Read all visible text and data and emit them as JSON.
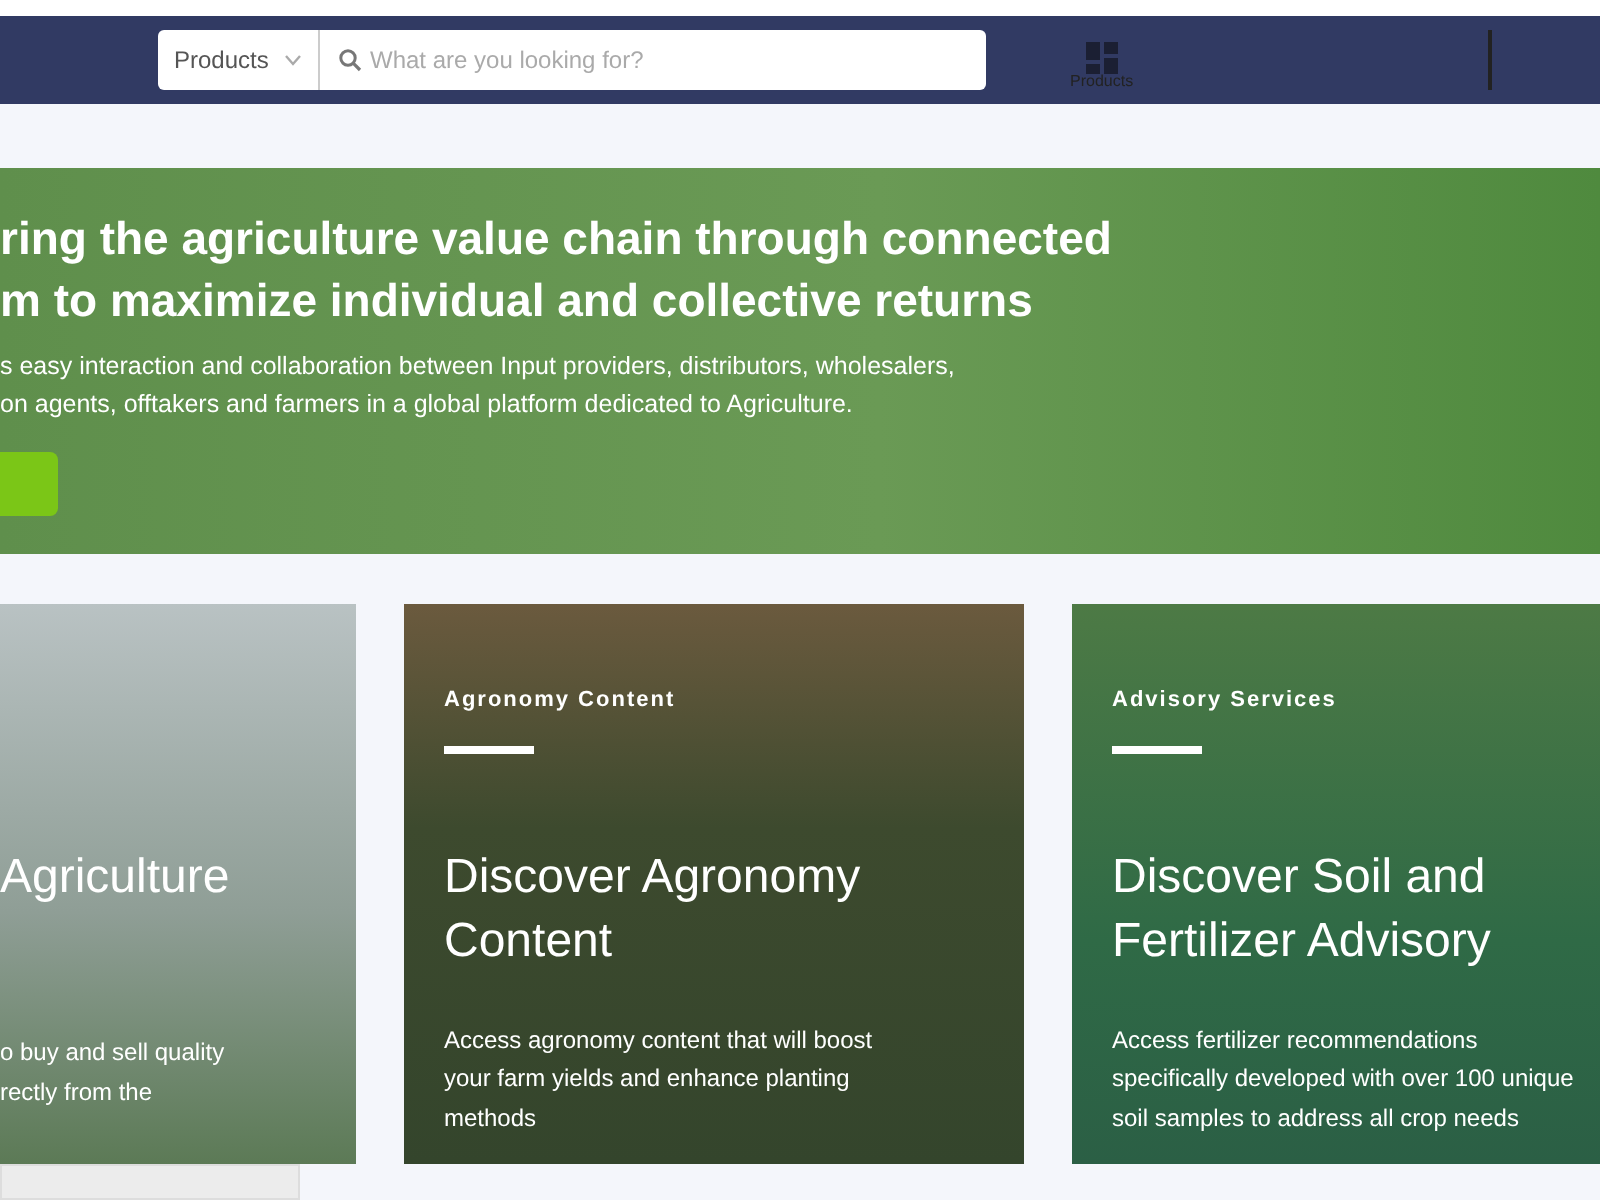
{
  "navbar": {
    "category_select": "Products",
    "search": {
      "placeholder": "What are you looking for?"
    },
    "products_link": "Products"
  },
  "hero": {
    "title_lines": [
      "ring the agriculture value chain through connected",
      "m to maximize individual and collective returns"
    ],
    "description_lines": [
      "s easy interaction and collaboration between Input providers, distributors, wholesalers,",
      "on agents, offtakers and farmers in a global platform dedicated to Agriculture."
    ]
  },
  "cards": [
    {
      "kind": "wheat",
      "title_lines": [
        "Agriculture"
      ],
      "description_lines": [
        "o buy and sell quality",
        "rectly from the"
      ]
    },
    {
      "kind": "field",
      "label": "Agronomy Content",
      "title_lines": [
        "Discover Agronomy",
        "Content"
      ],
      "description_lines": [
        "Access agronomy content that will boost",
        "your farm yields and enhance planting",
        "methods"
      ]
    },
    {
      "kind": "people",
      "label": "Advisory Services",
      "title_lines": [
        "Discover Soil and",
        "Fertilizer Advisory"
      ],
      "description_lines": [
        "Access fertilizer recommendations",
        "specifically developed with over 100 unique",
        "soil samples to address all crop needs"
      ]
    }
  ]
}
